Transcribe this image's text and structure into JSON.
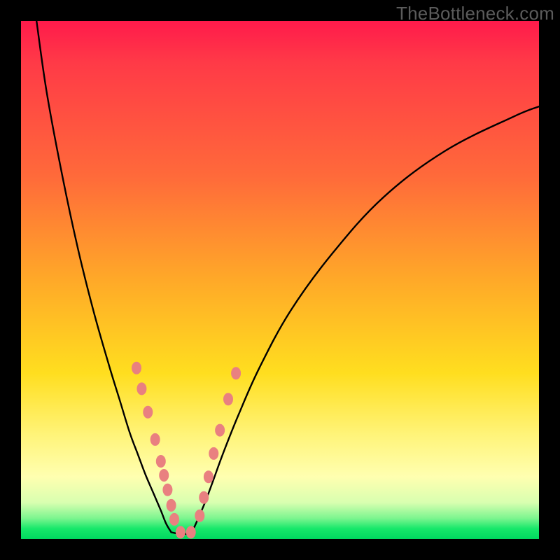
{
  "watermark": "TheBottleneck.com",
  "chart_data": {
    "type": "line",
    "title": "",
    "xlabel": "",
    "ylabel": "",
    "xlim": [
      0,
      100
    ],
    "ylim": [
      0,
      100
    ],
    "grid": false,
    "legend": false,
    "series": [
      {
        "name": "left-branch",
        "x": [
          3,
          5,
          8,
          11,
          14,
          17,
          19,
          21,
          22.5,
          24,
          25.5,
          27,
          28,
          29
        ],
        "y": [
          100,
          86,
          70,
          56,
          44,
          33.5,
          27,
          20.5,
          16.5,
          12.5,
          9,
          5.5,
          3,
          1.3
        ],
        "stroke": "#000000"
      },
      {
        "name": "right-branch",
        "x": [
          33,
          34,
          35.5,
          37,
          39,
          42,
          46,
          52,
          60,
          70,
          82,
          95,
          100
        ],
        "y": [
          1.3,
          3.5,
          7,
          11,
          16.5,
          24,
          33,
          44,
          55,
          66,
          75,
          81.5,
          83.5
        ],
        "stroke": "#000000"
      },
      {
        "name": "valley-floor",
        "x": [
          29,
          30.5,
          32,
          33
        ],
        "y": [
          1.3,
          1.0,
          1.0,
          1.3
        ],
        "stroke": "#000000"
      }
    ],
    "markers": {
      "name": "highlighted-points",
      "color": "#e98080",
      "rx": 7,
      "ry": 9,
      "points": [
        {
          "x": 22.3,
          "y": 33.0
        },
        {
          "x": 23.3,
          "y": 29.0
        },
        {
          "x": 24.5,
          "y": 24.5
        },
        {
          "x": 25.9,
          "y": 19.2
        },
        {
          "x": 27.0,
          "y": 15.0
        },
        {
          "x": 27.6,
          "y": 12.3
        },
        {
          "x": 28.3,
          "y": 9.5
        },
        {
          "x": 29.0,
          "y": 6.5
        },
        {
          "x": 29.6,
          "y": 3.8
        },
        {
          "x": 30.8,
          "y": 1.3
        },
        {
          "x": 32.8,
          "y": 1.3
        },
        {
          "x": 34.5,
          "y": 4.5
        },
        {
          "x": 35.3,
          "y": 8.0
        },
        {
          "x": 36.2,
          "y": 12.0
        },
        {
          "x": 37.2,
          "y": 16.5
        },
        {
          "x": 38.4,
          "y": 21.0
        },
        {
          "x": 40.0,
          "y": 27.0
        },
        {
          "x": 41.5,
          "y": 32.0
        }
      ]
    }
  }
}
